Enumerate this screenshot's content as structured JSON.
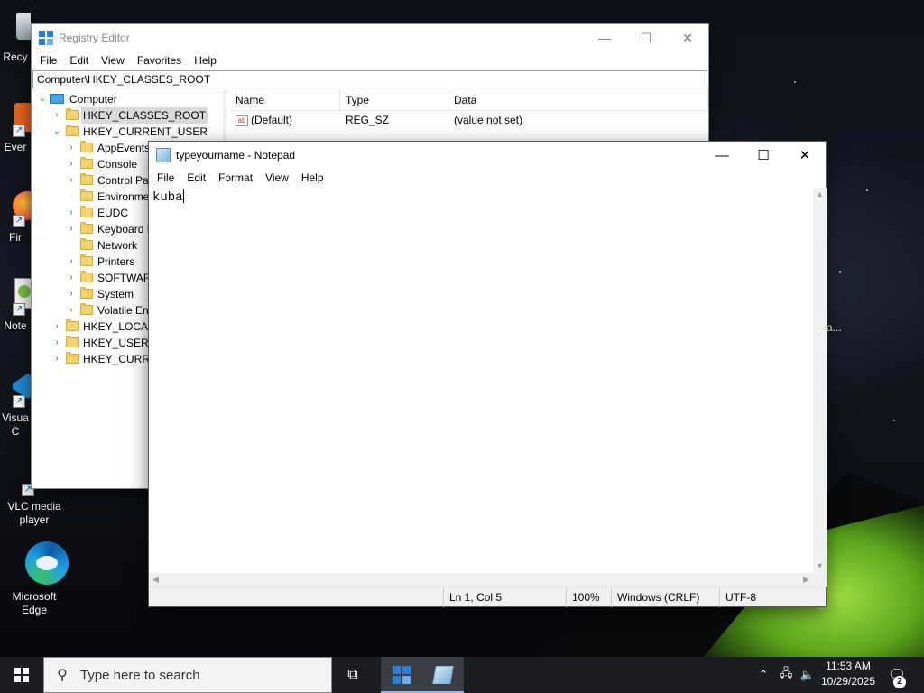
{
  "desktop": {
    "icons": [
      {
        "label": "Recy",
        "icon": "recycle-bin-icon"
      },
      {
        "label": "Ever",
        "icon": "everything-icon"
      },
      {
        "label": "Fir",
        "icon": "firefox-icon"
      },
      {
        "label": "Note",
        "icon": "notepad-plus-plus-icon"
      },
      {
        "label": "Visua C",
        "icon": "visual-studio-code-icon"
      },
      {
        "label": "VLC media player",
        "icon": "vlc-icon"
      },
      {
        "label": "Microsoft Edge",
        "icon": "edge-icon"
      }
    ],
    "partial_label_right": "a..."
  },
  "regedit": {
    "title": "Registry Editor",
    "menu": [
      "File",
      "Edit",
      "View",
      "Favorites",
      "Help"
    ],
    "address": "Computer\\HKEY_CLASSES_ROOT",
    "tree": {
      "root": "Computer",
      "hkcr": "HKEY_CLASSES_ROOT",
      "hkcu": "HKEY_CURRENT_USER",
      "hkcu_children": [
        "AppEvents",
        "Console",
        "Control Pa",
        "Environme",
        "EUDC",
        "Keyboard L",
        "Network",
        "Printers",
        "SOFTWARE",
        "System",
        "Volatile Env"
      ],
      "hklm": "HKEY_LOCAL",
      "hku": "HKEY_USERS",
      "hkcc": "HKEY_CURRE"
    },
    "list": {
      "columns": [
        "Name",
        "Type",
        "Data"
      ],
      "rows": [
        {
          "name": "(Default)",
          "type": "REG_SZ",
          "data": "(value not set)"
        }
      ]
    }
  },
  "notepad": {
    "title": "typeyourname - Notepad",
    "menu": [
      "File",
      "Edit",
      "Format",
      "View",
      "Help"
    ],
    "content": "kuba",
    "status": {
      "position": "Ln 1, Col 5",
      "zoom": "100%",
      "line_ending": "Windows (CRLF)",
      "encoding": "UTF-8"
    }
  },
  "taskbar": {
    "search_placeholder": "Type here to search",
    "time": "11:53 AM",
    "date": "10/29/2025",
    "notification_count": "2"
  }
}
